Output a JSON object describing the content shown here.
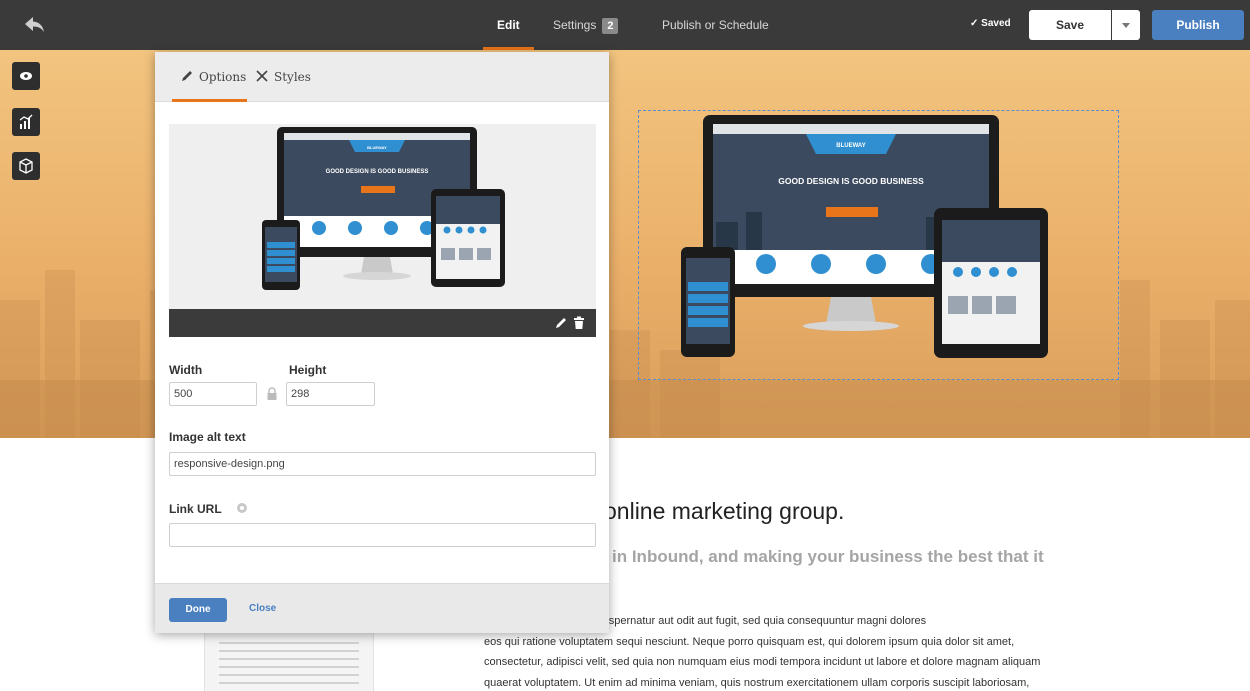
{
  "topbar": {
    "tabs": [
      {
        "label": "Edit"
      },
      {
        "label": "Settings",
        "badge": "2"
      },
      {
        "label": "Publish or Schedule"
      }
    ],
    "saved_status": "✓ Saved",
    "save_label": "Save",
    "publish_label": "Publish"
  },
  "panel": {
    "tabs": {
      "options": "Options",
      "styles": "Styles"
    },
    "width_label": "Width",
    "width_value": "500",
    "height_label": "Height",
    "height_value": "298",
    "alt_label": "Image alt text",
    "alt_value": "responsive-design.png",
    "link_label": "Link URL",
    "link_value": "",
    "done_label": "Done",
    "close_label": "Close"
  },
  "preview_image": {
    "brand": "BLUEWAY",
    "tagline": "GOOD DESIGN IS GOOD BUSINESS",
    "cta": "LEARN MORE",
    "mobile_menu": [
      "HOMEPAGE",
      "ABOUT US",
      "VISIT SHOP",
      "CONTACT"
    ]
  },
  "content": {
    "headline": "online marketing group.",
    "subheadline": "in Inbound, and making your business the best that it",
    "paragraph_lines": [
      "ptatem quia voluptas sit aspernatur aut odit aut fugit, sed quia consequuntur magni dolores",
      "eos qui ratione voluptatem sequi nesciunt. Neque porro quisquam est, qui dolorem ipsum quia dolor sit amet,",
      "consectetur, adipisci velit, sed quia non numquam eius modi tempora incidunt ut labore et dolore magnam aliquam",
      "quaerat voluptatem. Ut enim ad minima veniam, quis nostrum exercitationem ullam corporis suscipit laboriosam,"
    ]
  },
  "colors": {
    "accent": "#e8751a",
    "primary_blue": "#4a7fc0",
    "topbar": "#3a3a3a",
    "hero": "#eab06a"
  },
  "icons": [
    "back-arrow-icon",
    "eye-icon",
    "analytics-icon",
    "cube-icon",
    "pencil-icon",
    "scissors-icon",
    "trash-icon",
    "lock-icon",
    "help-icon",
    "chevron-down-icon"
  ]
}
